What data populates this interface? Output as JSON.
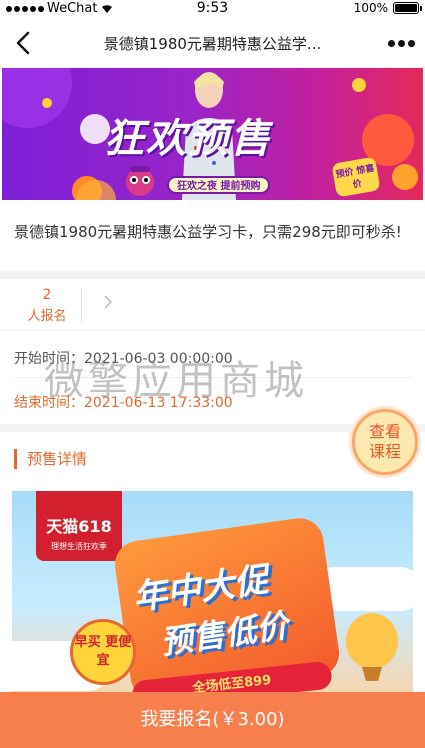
{
  "status_bar": {
    "carrier": "WeChat",
    "time": "9:53",
    "battery_text": "100%",
    "battery_level": 1.0
  },
  "nav": {
    "title": "景德镇1980元暑期特惠公益学..."
  },
  "banner": {
    "headline": "狂欢预售",
    "subline": "狂欢之夜 提前预购",
    "badge": "预价 惊喜价"
  },
  "product": {
    "title": "景德镇1980元暑期特惠公益学习卡，只需298元即可秒杀!"
  },
  "signup": {
    "count": "2",
    "label": "人报名"
  },
  "times": {
    "start": "开始时间：2021-06-03 00:00:00",
    "end": "结束时间：2021-06-13 17:33:00"
  },
  "watermark": "微擎应用商城",
  "float_button": {
    "line1": "查看",
    "line2": "课程"
  },
  "section": {
    "title": "预售详情"
  },
  "promo": {
    "brand": "天猫618",
    "brand_sub": "理想生活狂欢季",
    "headline1": "年中大促",
    "headline2": "预售低价",
    "round": "早买 更便宜",
    "ribbon": "全场低至899"
  },
  "bottom": {
    "label": "我要报名(￥3.00)"
  },
  "colors": {
    "accent": "#e8662f",
    "bottom_bar": "#f77f4d"
  }
}
